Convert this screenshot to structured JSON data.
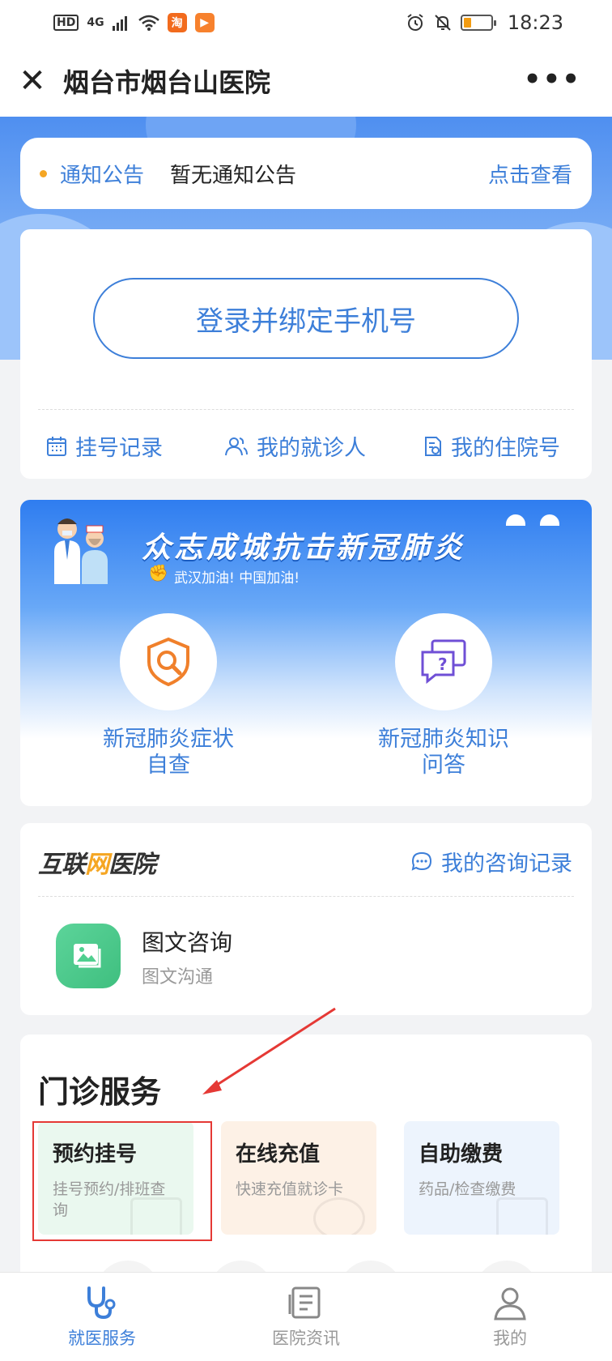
{
  "statusbar": {
    "network": "4G",
    "time": "18:23",
    "app_icons": [
      "taobao-icon",
      "video-icon"
    ]
  },
  "navbar": {
    "title": "烟台市烟台山医院",
    "close_icon": "close-icon",
    "more_icon": "more-icon"
  },
  "notice": {
    "label": "通知公告",
    "text": "暂无通知公告",
    "link": "点击查看"
  },
  "login": {
    "button_label": "登录并绑定手机号",
    "quick_links": [
      {
        "label": "挂号记录",
        "icon": "calendar-icon"
      },
      {
        "label": "我的就诊人",
        "icon": "users-icon"
      },
      {
        "label": "我的住院号",
        "icon": "document-icon"
      }
    ]
  },
  "covid": {
    "title": "众志成城抗击新冠肺炎",
    "subtitle": "武汉加油! 中国加油!",
    "items": [
      {
        "line1": "新冠肺炎症状",
        "line2": "自查",
        "icon": "shield-search-icon"
      },
      {
        "line1": "新冠肺炎知识",
        "line2": "问答",
        "icon": "chat-question-icon"
      }
    ]
  },
  "internet_hospital": {
    "logo_part1": "互联",
    "logo_part2": "网",
    "logo_part3": "医院",
    "record_link": "我的咨询记录",
    "service_title": "图文咨询",
    "service_sub": "图文沟通"
  },
  "outpatient": {
    "title": "门诊服务",
    "services": [
      {
        "title": "预约挂号",
        "sub": "挂号预约/排班查询"
      },
      {
        "title": "在线充值",
        "sub": "快速充值就诊卡"
      },
      {
        "title": "自助缴费",
        "sub": "药品/检查缴费"
      }
    ]
  },
  "tabbar": {
    "tabs": [
      {
        "label": "就医服务",
        "active": true
      },
      {
        "label": "医院资讯",
        "active": false
      },
      {
        "label": "我的",
        "active": false
      }
    ]
  },
  "colors": {
    "primary": "#3d7fd9",
    "accent": "#f5a623",
    "highlight": "#e53935"
  }
}
